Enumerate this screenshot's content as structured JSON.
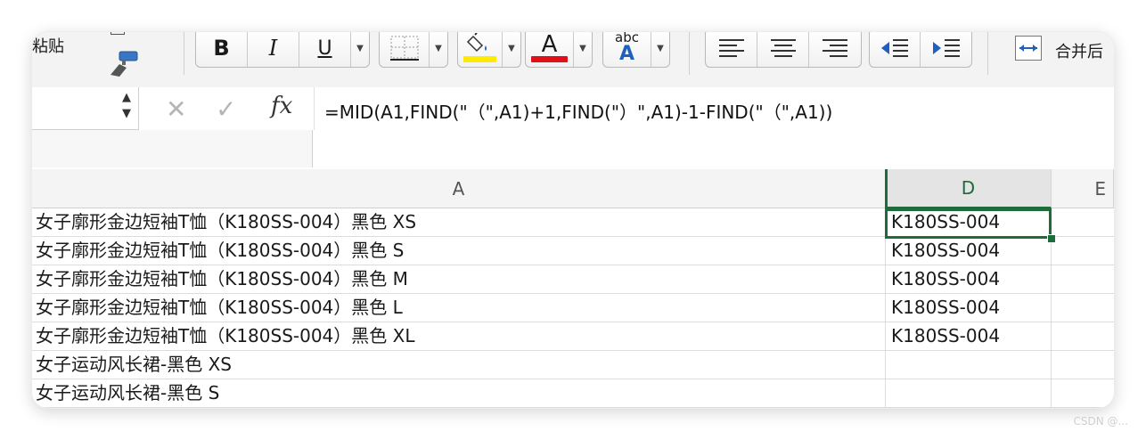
{
  "ribbon": {
    "paste_label": "粘贴",
    "merge_label": "合并后",
    "font_color_letter": "A",
    "wrap_text_top": "abc",
    "wrap_text_bottom": "A",
    "colors": {
      "fill": "#ffeb00",
      "font": "#e0101a",
      "indent_accent": "#1f5fbf"
    },
    "icons": [
      "format-painter-icon",
      "bold-icon",
      "italic-icon",
      "underline-icon",
      "borders-icon",
      "fill-color-icon",
      "font-color-icon",
      "wrap-text-icon",
      "align-left-icon",
      "align-center-icon",
      "align-right-icon",
      "decrease-indent-icon",
      "increase-indent-icon",
      "merge-cells-icon"
    ]
  },
  "formula_bar": {
    "name_box": "",
    "cancel_symbol": "✕",
    "enter_symbol": "✓",
    "fx_label": "fx",
    "formula": "=MID(A1,FIND(\"（\",A1)+1,FIND(\"）\",A1)-1-FIND(\"（\",A1))"
  },
  "grid": {
    "columns": [
      "A",
      "D",
      "E"
    ],
    "selected_column": "D",
    "selected_cell": "D1",
    "rows": [
      {
        "a": "女子廓形金边短袖T恤（K180SS-004）黑色 XS",
        "d": "K180SS-004"
      },
      {
        "a": "女子廓形金边短袖T恤（K180SS-004）黑色 S",
        "d": "K180SS-004"
      },
      {
        "a": "女子廓形金边短袖T恤（K180SS-004）黑色 M",
        "d": "K180SS-004"
      },
      {
        "a": "女子廓形金边短袖T恤（K180SS-004）黑色 L",
        "d": "K180SS-004"
      },
      {
        "a": "女子廓形金边短袖T恤（K180SS-004）黑色 XL",
        "d": "K180SS-004"
      },
      {
        "a": "女子运动风长裙-黑色 XS",
        "d": ""
      },
      {
        "a": "女子运动风长裙-黑色 S",
        "d": ""
      }
    ]
  },
  "watermark": "CSDN @..."
}
